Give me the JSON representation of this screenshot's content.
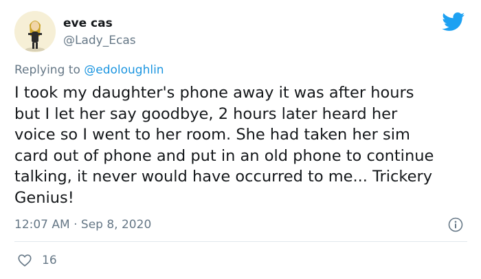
{
  "author": {
    "display_name": "eve cas",
    "handle": "@Lady_Ecas",
    "avatar_icon": "cartoon-avatar-icon"
  },
  "brand": {
    "icon": "twitter-bird-icon",
    "color": "#1da1f2"
  },
  "reply": {
    "prefix": "Replying to",
    "mention": "@edoloughlin",
    "mention_color": "#1b95e0"
  },
  "tweet": {
    "lines": [
      "I took my daughter's phone away it was after hours",
      "but I let her say goodbye, 2 hours later heard her",
      "voice so I went to her room. She had taken her sim",
      "card out of phone and put in an old phone to continue",
      "talking, it never would have occurred to me... Trickery",
      "Genius!"
    ],
    "time": "12:07 AM",
    "separator": "·",
    "date": "Sep 8, 2020"
  },
  "actions": {
    "info_icon": "info-icon",
    "like_icon": "heart-icon",
    "like_count": "16"
  },
  "colors": {
    "text": "#14171a",
    "secondary": "#657786",
    "divider": "#e1e8ed"
  }
}
